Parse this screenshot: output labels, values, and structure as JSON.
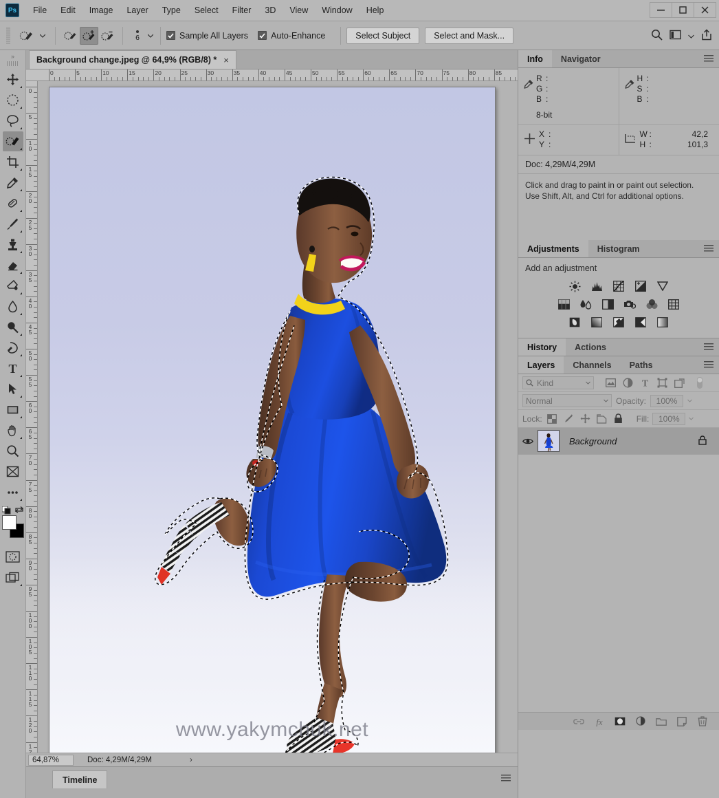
{
  "app": {
    "name": "Ps",
    "logo_color": "#3dc0f0"
  },
  "menubar": {
    "items": [
      "File",
      "Edit",
      "Image",
      "Layer",
      "Type",
      "Select",
      "Filter",
      "3D",
      "View",
      "Window",
      "Help"
    ]
  },
  "window_controls": {
    "minimize": "minimize-icon",
    "maximize": "maximize-icon",
    "close": "close-icon"
  },
  "options_bar": {
    "tool_preset_icon": "quick-selection-icon",
    "modes": [
      "new-selection",
      "add-to-selection",
      "subtract-from-selection"
    ],
    "active_mode_index": 1,
    "brush_size": "6",
    "sample_all_layers": {
      "label": "Sample All Layers",
      "checked": true
    },
    "auto_enhance": {
      "label": "Auto-Enhance",
      "checked": true
    },
    "select_subject": "Select Subject",
    "select_and_mask": "Select and Mask...",
    "right_icons": [
      "search-icon",
      "workspace-icon",
      "chevron-down-icon",
      "share-icon"
    ]
  },
  "toolbar": {
    "tools": [
      {
        "name": "move-tool",
        "selected": false
      },
      {
        "name": "marquee-tool",
        "selected": false
      },
      {
        "name": "lasso-tool",
        "selected": false
      },
      {
        "name": "quick-selection-tool",
        "selected": true
      },
      {
        "name": "crop-tool",
        "selected": false
      },
      {
        "name": "eyedropper-tool",
        "selected": false
      },
      {
        "name": "healing-brush-tool",
        "selected": false
      },
      {
        "name": "brush-tool",
        "selected": false
      },
      {
        "name": "clone-stamp-tool",
        "selected": false
      },
      {
        "name": "eraser-tool",
        "selected": false
      },
      {
        "name": "gradient-tool",
        "selected": false
      },
      {
        "name": "blur-tool",
        "selected": false
      },
      {
        "name": "dodge-tool",
        "selected": false
      },
      {
        "name": "pen-tool",
        "selected": false
      },
      {
        "name": "type-tool",
        "selected": false
      },
      {
        "name": "path-selection-tool",
        "selected": false
      },
      {
        "name": "rectangle-tool",
        "selected": false
      },
      {
        "name": "hand-tool",
        "selected": false
      },
      {
        "name": "zoom-tool",
        "selected": false
      },
      {
        "name": "edit-toolbar",
        "selected": false
      },
      {
        "name": "more-tools",
        "selected": false
      }
    ],
    "foreground_color": "#ffffff",
    "background_color": "#000000"
  },
  "document": {
    "tab_title": "Background change.jpeg @ 64,9% (RGB/8) *",
    "close_label": "×",
    "zoom_level": "64,87%",
    "doc_size": "Doc: 4,29M/4,29M",
    "status_arrow": "›",
    "watermark": "www.yakymchuk.net",
    "ruler_h_max": 85,
    "ruler_v_max": 125,
    "ruler_step": 5
  },
  "timeline": {
    "tab_label": "Timeline"
  },
  "info_panel": {
    "tabs": [
      "Info",
      "Navigator"
    ],
    "active_tab": "Info",
    "rgb": {
      "labels": [
        "R",
        "G",
        "B"
      ],
      "values": [
        "",
        "",
        ""
      ]
    },
    "hsb": {
      "labels": [
        "H",
        "S",
        "B"
      ],
      "values": [
        "",
        "",
        ""
      ]
    },
    "bit_depth": "8-bit",
    "xy": {
      "labels": [
        "X",
        "Y"
      ],
      "values": [
        "",
        ""
      ]
    },
    "wh": {
      "labels": [
        "W",
        "H"
      ],
      "values": [
        "42,2",
        "101,3"
      ]
    },
    "doc_line": "Doc: 4,29M/4,29M",
    "hint_line_1": "Click and drag to paint in or paint out selection.",
    "hint_line_2": "Use Shift, Alt, and Ctrl for additional options."
  },
  "adjustments_panel": {
    "tabs": [
      "Adjustments",
      "Histogram"
    ],
    "active_tab": "Adjustments",
    "label": "Add an adjustment",
    "rows": [
      [
        "brightness-contrast-icon",
        "levels-icon",
        "curves-icon",
        "exposure-icon",
        "vibrance-icon"
      ],
      [
        "hue-saturation-icon",
        "color-balance-icon",
        "black-white-icon",
        "photo-filter-icon",
        "channel-mixer-icon",
        "color-lookup-icon"
      ],
      [
        "invert-icon",
        "posterize-icon",
        "threshold-icon",
        "gradient-map-icon",
        "selective-color-icon"
      ]
    ]
  },
  "history_panel": {
    "tabs": [
      "History",
      "Actions"
    ],
    "active_tab": "History"
  },
  "layers_panel": {
    "tabs": [
      "Layers",
      "Channels",
      "Paths"
    ],
    "active_tab": "Layers",
    "filter": {
      "kind_label": "Kind",
      "icons": [
        "pixel-layer-icon",
        "adjustment-layer-icon",
        "type-layer-icon",
        "shape-layer-icon",
        "smart-object-icon"
      ],
      "toggle": "filter-toggle"
    },
    "blend_mode": "Normal",
    "opacity_label": "Opacity:",
    "opacity_value": "100%",
    "lock_label": "Lock:",
    "lock_icons": [
      "lock-transparent-pixels",
      "lock-image-pixels",
      "lock-position",
      "lock-artboard",
      "lock-all"
    ],
    "fill_label": "Fill:",
    "fill_value": "100%",
    "layers": [
      {
        "name": "Background",
        "visible": true,
        "locked": true,
        "selected": true
      }
    ],
    "footer_buttons": [
      "link-layers-icon",
      "layer-style-icon",
      "layer-mask-icon",
      "new-adjustment-icon",
      "new-group-icon",
      "new-layer-icon",
      "delete-layer-icon"
    ]
  }
}
